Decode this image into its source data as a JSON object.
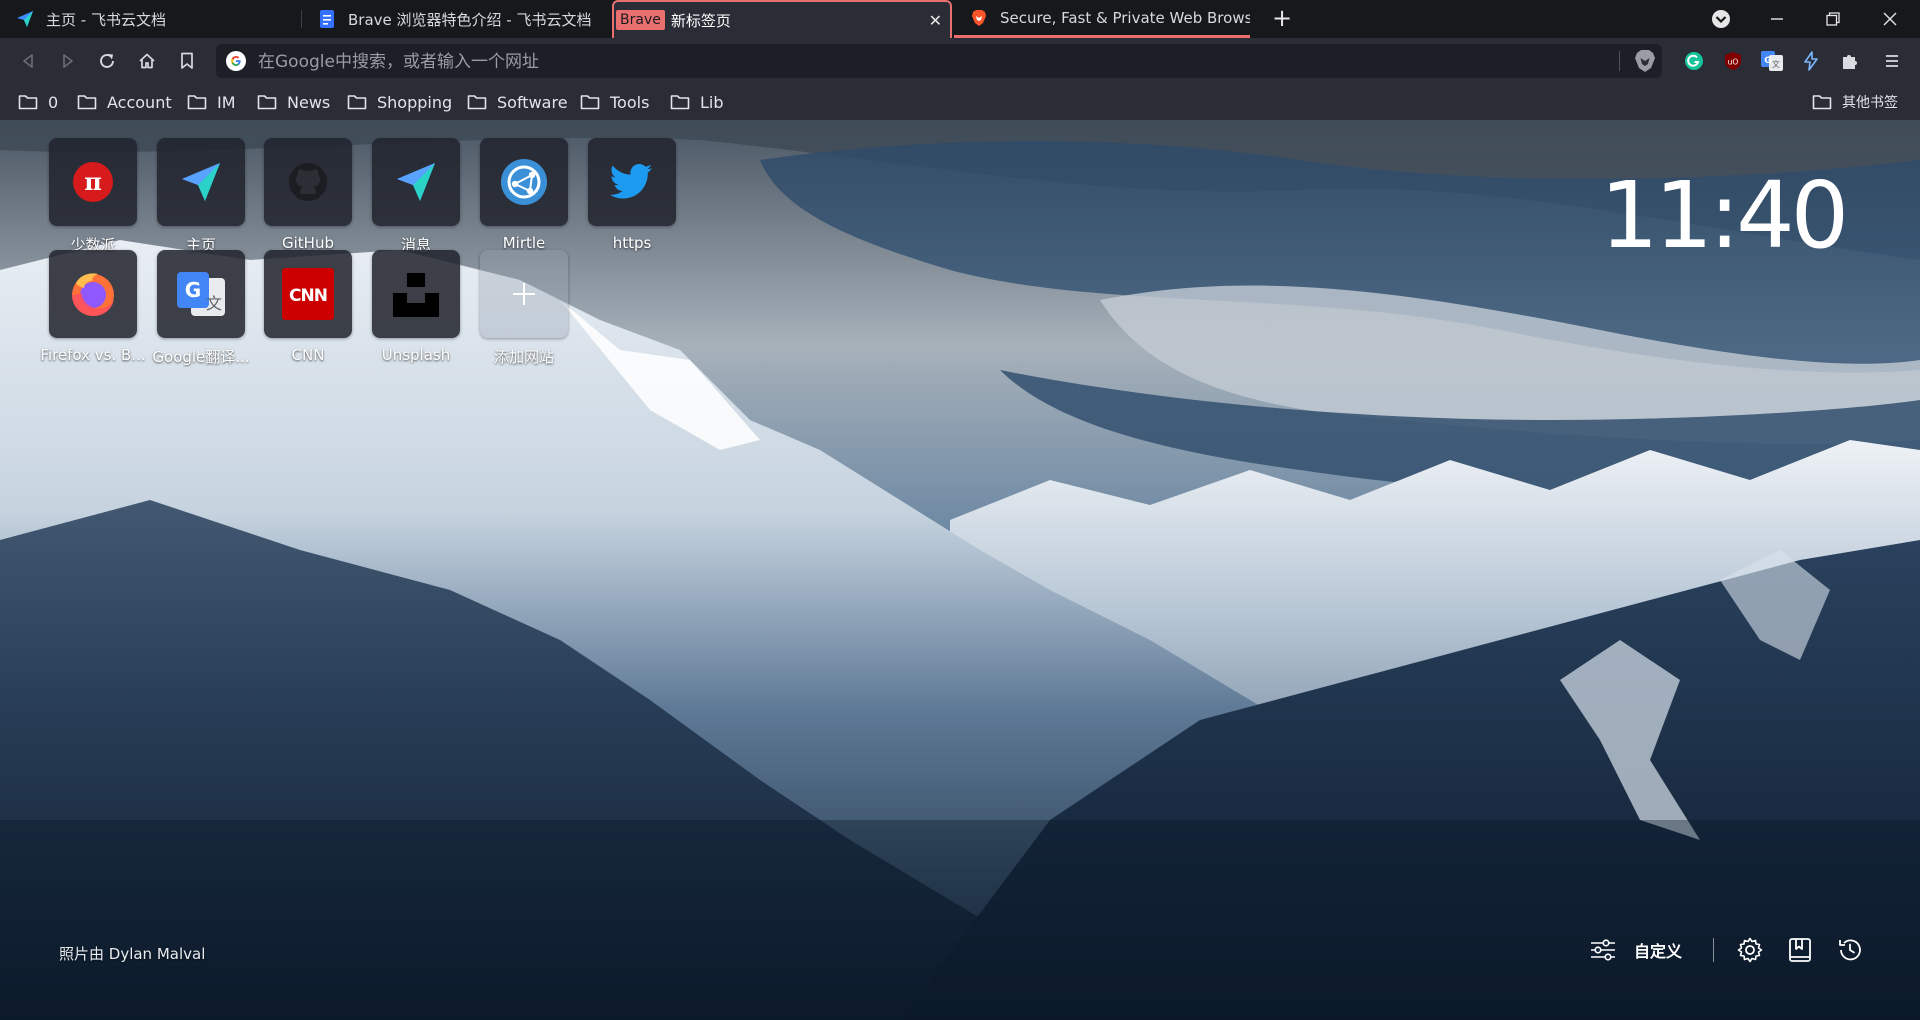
{
  "tabs": [
    {
      "title": "主页 - 飞书云文档",
      "icon": "feishu-icon"
    },
    {
      "title": "Brave 浏览器特色介绍 - 飞书云文档",
      "icon": "doc-icon"
    },
    {
      "group_label": "Brave",
      "title": "新标签页",
      "active": true,
      "icon": "none"
    },
    {
      "title": "Secure, Fast & Private Web Browser",
      "icon": "brave-icon"
    }
  ],
  "tab_close_symbol": "✕",
  "new_tab_symbol": "+",
  "address_bar": {
    "placeholder": "在Google中搜索，或者输入一个网址",
    "value": ""
  },
  "bookmarks": [
    {
      "label": "0"
    },
    {
      "label": "Account"
    },
    {
      "label": "IM"
    },
    {
      "label": "News"
    },
    {
      "label": "Shopping"
    },
    {
      "label": "Software"
    },
    {
      "label": "Tools"
    },
    {
      "label": "Lib"
    }
  ],
  "other_bookmarks": "其他书签",
  "top_sites_row1": [
    {
      "name": "少数派",
      "icon": "sspai-icon"
    },
    {
      "name": "主页",
      "icon": "feishu-icon"
    },
    {
      "name": "GitHub",
      "icon": "github-icon"
    },
    {
      "name": "消息",
      "icon": "feishu-icon"
    },
    {
      "name": "Mirtle",
      "icon": "mirtle-icon"
    },
    {
      "name": "https",
      "icon": "twitter-icon"
    }
  ],
  "top_sites_row2": [
    {
      "name": "Firefox vs. B...",
      "icon": "firefox-icon"
    },
    {
      "name": "Google翻译...",
      "icon": "google-translate-icon"
    },
    {
      "name": "CNN",
      "icon": "cnn-icon"
    },
    {
      "name": "Unsplash",
      "icon": "unsplash-icon"
    },
    {
      "name": "添加网站",
      "icon": "plus-icon"
    }
  ],
  "clock": "11:40",
  "photo_credit": "照片由 Dylan Malval",
  "customize_label": "自定义",
  "colors": {
    "accent": "#ea6f6f",
    "tab_strip": "#17181c",
    "toolbar": "#2a2c36"
  }
}
